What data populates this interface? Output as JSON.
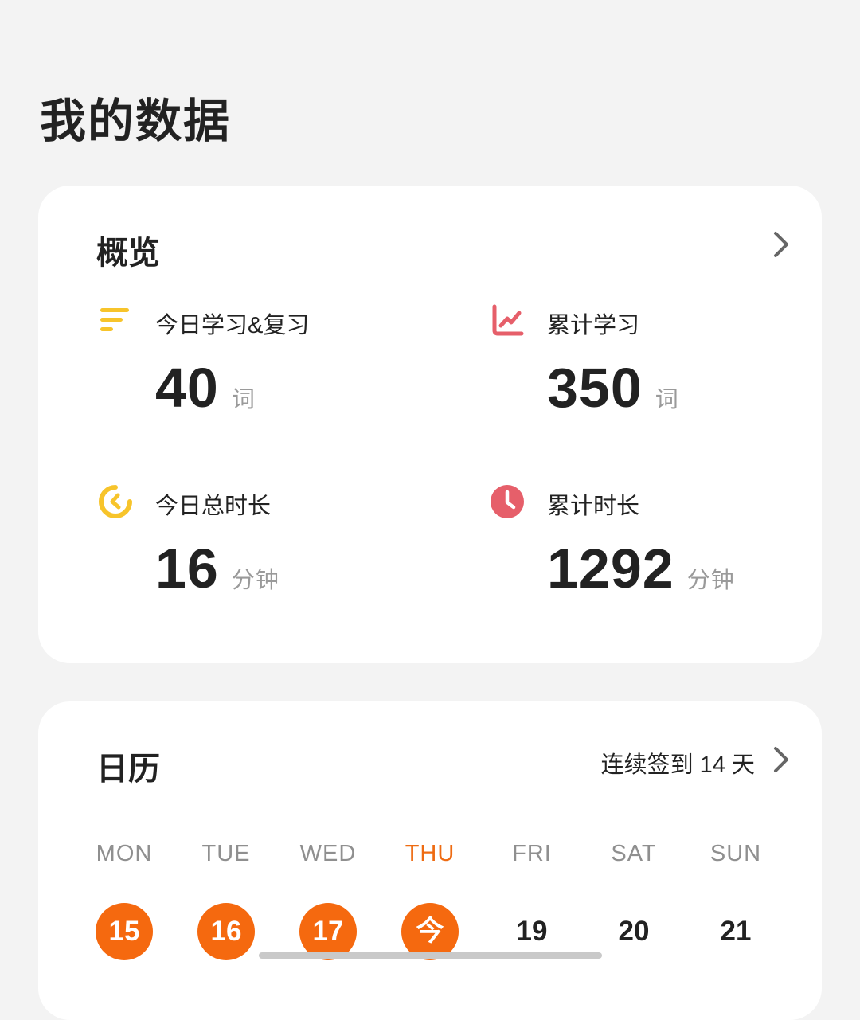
{
  "page": {
    "title": "我的数据"
  },
  "overview": {
    "title": "概览",
    "stats": [
      {
        "label": "今日学习&复习",
        "value": "40",
        "unit": "词",
        "icon": "lines-icon",
        "color": "#f7c42b"
      },
      {
        "label": "累计学习",
        "value": "350",
        "unit": "词",
        "icon": "line-chart-icon",
        "color": "#e65f6a"
      },
      {
        "label": "今日总时长",
        "value": "16",
        "unit": "分钟",
        "icon": "timer-icon",
        "color": "#f7c42b"
      },
      {
        "label": "累计时长",
        "value": "1292",
        "unit": "分钟",
        "icon": "clock-icon",
        "color": "#e65f6a"
      }
    ]
  },
  "calendar": {
    "title": "日历",
    "streak": "连续签到 14 天",
    "weekdays": [
      "MON",
      "TUE",
      "WED",
      "THU",
      "FRI",
      "SAT",
      "SUN"
    ],
    "days": [
      {
        "label": "15",
        "checked": true
      },
      {
        "label": "16",
        "checked": true
      },
      {
        "label": "17",
        "checked": true
      },
      {
        "label": "今",
        "checked": true
      },
      {
        "label": "19",
        "checked": false
      },
      {
        "label": "20",
        "checked": false
      },
      {
        "label": "21",
        "checked": false
      }
    ],
    "today_index": 3,
    "accent_color": "#f5690f"
  }
}
